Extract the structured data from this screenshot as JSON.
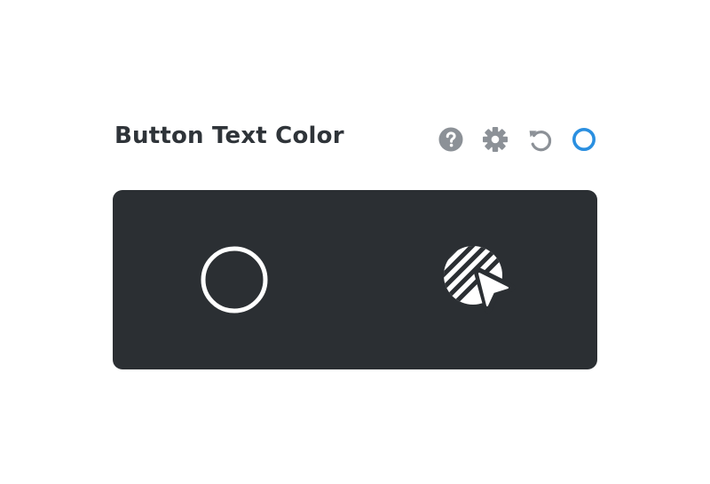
{
  "control": {
    "title": "Button Text Color",
    "header_icons": [
      {
        "name": "help-icon"
      },
      {
        "name": "gear-icon"
      },
      {
        "name": "reset-icon"
      },
      {
        "name": "status-ring-icon",
        "color": "#2a8fe0"
      }
    ],
    "color_field": {
      "background": "#2b2f33",
      "options": [
        {
          "name": "color-swatch-empty-icon",
          "state": "normal"
        },
        {
          "name": "hover-color-picker-icon",
          "state": "hover"
        }
      ]
    },
    "colors": {
      "title": "#2f3439",
      "icon_gray": "#8c9197",
      "accent": "#2a8fe0",
      "glyph": "#ffffff"
    }
  }
}
